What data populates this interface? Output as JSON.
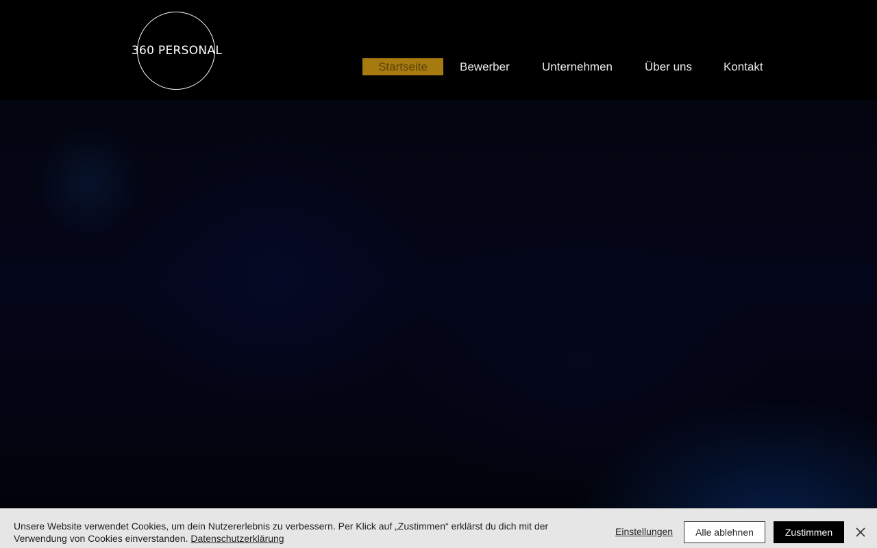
{
  "brand": {
    "logo_text": "360 PERSONAL"
  },
  "nav": {
    "items": [
      {
        "label": "Startseite",
        "active": true
      },
      {
        "label": "Bewerber",
        "active": false
      },
      {
        "label": "Unternehmen",
        "active": false
      },
      {
        "label": "Über uns",
        "active": false
      },
      {
        "label": "Kontakt",
        "active": false
      }
    ],
    "active_bg": "#a67a0f"
  },
  "cookie": {
    "text": "Unsere Website verwendet Cookies, um dein Nutzererlebnis zu verbessern. Per Klick auf „Zustimmen“ erklärst du dich mit der Verwendung von Cookies einverstanden.",
    "privacy_link": "Datenschutzerklärung",
    "settings_label": "Einstellungen",
    "reject_label": "Alle ablehnen",
    "accept_label": "Zustimmen",
    "close_icon": "close-icon"
  }
}
